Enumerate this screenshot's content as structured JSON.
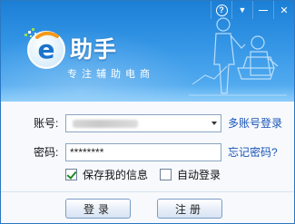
{
  "window": {
    "controls": {
      "help_glyph": "?",
      "menu_glyph": "▼",
      "minimize_glyph": "—",
      "close_glyph": "✕"
    }
  },
  "banner": {
    "brand_name": "助手",
    "logo_letter": "e",
    "slogan": "专注辅助电商",
    "colors": {
      "top": "#1b7fd6",
      "bottom": "#5eb3f3"
    }
  },
  "form": {
    "account_label": "账号:",
    "account_value_obscured": true,
    "password_label": "密码:",
    "password_value": "********",
    "multi_account_link": "多账号登录",
    "forgot_password_link": "忘记密码?",
    "remember_label": "保存我的信息",
    "remember_checked": true,
    "auto_login_label": "自动登录",
    "auto_login_checked": false,
    "login_button": "登录",
    "register_button": "注册"
  }
}
